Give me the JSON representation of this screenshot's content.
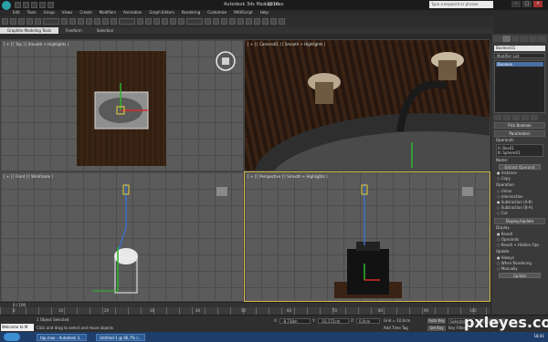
{
  "titlebar": {
    "app_title": "Autodesk 3ds Max  2010",
    "project_name": "tap.max",
    "search_placeholder": "Type a keyword or phrase"
  },
  "menu": [
    "Edit",
    "Tools",
    "Group",
    "Views",
    "Create",
    "Modifiers",
    "Animation",
    "Graph Editors",
    "Rendering",
    "Customize",
    "MAXScript",
    "Help"
  ],
  "ribbon_tabs": [
    "Graphite Modeling Tools",
    "Freeform",
    "Selection"
  ],
  "viewports": {
    "top_label": "[ + ] [ Top ] [ Smooth + Highlights ]",
    "camera_label": "[ + ] [ Camera01 ] [ Smooth + Highlights ]",
    "front_label": "[ + ] [ Front ] [ Wireframe ]",
    "perspective_label": "[ + ] [ Perspective ] [ Smooth + Highlights ]"
  },
  "command_panel": {
    "object_name": "Boolean01",
    "modifier_list": "Modifier List",
    "stack_item": "Boolean",
    "pick_rollout": "Pick Boolean",
    "params_rollout": "Parameters",
    "operands_label": "Operands",
    "operands": [
      "A: Box01",
      "B: Sphere01"
    ],
    "name_label": "Name:",
    "extract_btn": "Extract Operand",
    "instance": "Instance",
    "copy": "Copy",
    "operation_label": "Operation",
    "operations": [
      "Union",
      "Intersection",
      "Subtraction (A-B)",
      "Subtraction (B-A)",
      "Cut"
    ],
    "cut_options": [
      "Refine",
      "Split",
      "Remove Inside",
      "Remove Outside"
    ],
    "display_rollout": "Display/Update",
    "display_label": "Display",
    "display_options": [
      "Result",
      "Operands",
      "Result + Hidden Ops"
    ],
    "update_label": "Update",
    "update_options": [
      "Always",
      "When Rendering",
      "Manually"
    ],
    "update_btn": "Update"
  },
  "timeline": {
    "frame_readout": "0 / 100",
    "ruler_ticks": [
      "0",
      "10",
      "20",
      "30",
      "40",
      "50",
      "60",
      "70",
      "80",
      "90",
      "100"
    ]
  },
  "status": {
    "welcome": "Welcome to M",
    "line1": "1 Object Selected",
    "line2": "Click and drag to select and move objects",
    "x_label": "X:",
    "x_value": "-8,738m",
    "y_label": "Y:",
    "y_value": "-10,172cm",
    "z_label": "Z:",
    "z_value": "0,0cm",
    "grid": "Grid = 10,0cm",
    "add_time_tag": "Add Time Tag",
    "auto_key": "Auto Key",
    "set_key": "Set Key",
    "selected": "Selected",
    "key_filters": "Key Filters..."
  },
  "watermark": "pxleyes.com",
  "taskbar": {
    "tasks": [
      "tap.max - Autodesk 3...",
      "Untitled-1 @ 66,7% (..."
    ],
    "clock": "18:41"
  }
}
